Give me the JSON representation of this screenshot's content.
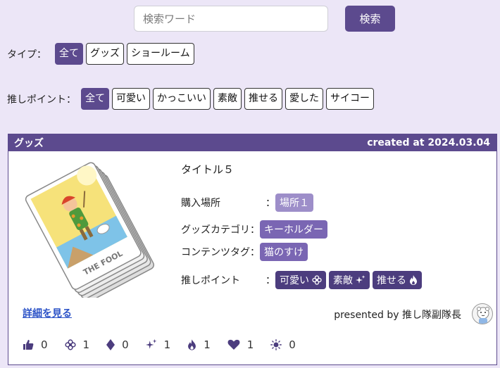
{
  "search": {
    "placeholder": "検索ワード",
    "button_label": "検索"
  },
  "type_filter": {
    "label": "タイプ：",
    "options": [
      "全て",
      "グッズ",
      "ショールーム"
    ],
    "selected": "全て"
  },
  "point_filter": {
    "label": "推しポイント：",
    "options": [
      "全て",
      "可愛い",
      "かっこいい",
      "素敵",
      "推せる",
      "愛した",
      "サイコー"
    ],
    "selected": "全て"
  },
  "card": {
    "category": "グッズ",
    "created": "created at 2024.03.04",
    "title": "タイトル５",
    "fields": {
      "place_label": "購入場所",
      "place_value": "場所１",
      "goods_category_label": "グッズカテゴリ",
      "goods_category_value": "キーホルダー",
      "content_tag_label": "コンテンツタグ",
      "content_tag_value": "猫のすけ",
      "points_label": "推しポイント",
      "points": [
        "可愛い",
        "素敵",
        "推せる"
      ]
    },
    "colon": "：",
    "details_link": "詳細を見る",
    "presenter": "presented by 推し隊副隊長",
    "reactions": [
      {
        "icon": "thumbs-up-icon",
        "count": "0"
      },
      {
        "icon": "flower-icon",
        "count": "1"
      },
      {
        "icon": "diamond-icon",
        "count": "0"
      },
      {
        "icon": "sparkles-icon",
        "count": "1"
      },
      {
        "icon": "fire-icon",
        "count": "1"
      },
      {
        "icon": "heart-icon",
        "count": "1"
      },
      {
        "icon": "sun-icon",
        "count": "0"
      }
    ]
  },
  "colors": {
    "accent": "#5c4a8e",
    "background": "#ece6f7",
    "link": "#2b52c7"
  }
}
